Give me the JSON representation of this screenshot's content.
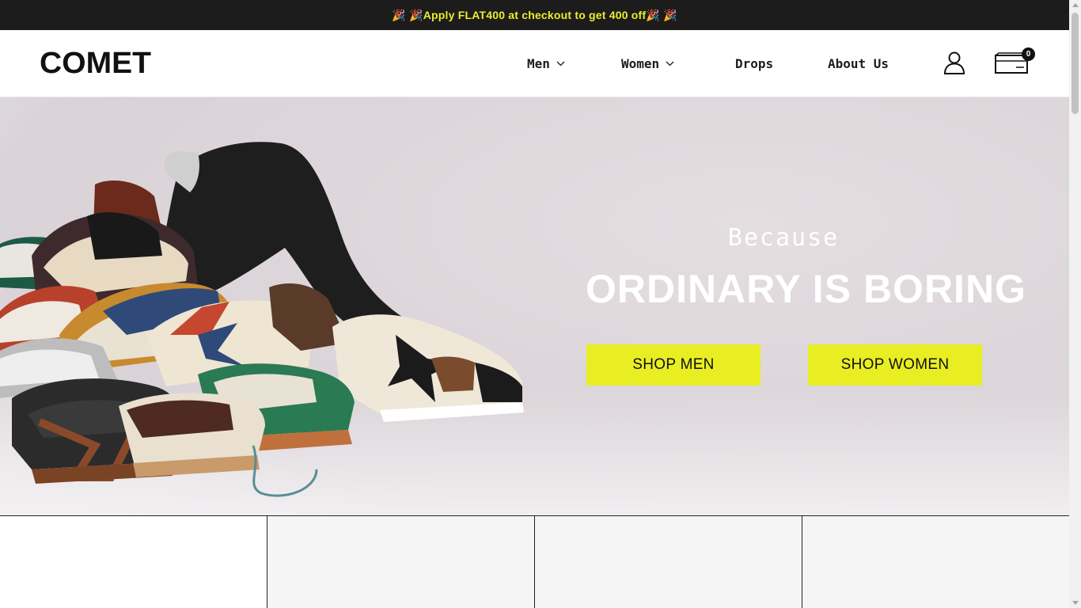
{
  "announcement": {
    "text": "🎉 🎉Apply FLAT400 at checkout to get 400 off🎉 🎉"
  },
  "header": {
    "logo_text": "COMET",
    "nav": [
      {
        "label": "Men",
        "has_dropdown": true
      },
      {
        "label": "Women",
        "has_dropdown": true
      },
      {
        "label": "Drops",
        "has_dropdown": false
      },
      {
        "label": "About Us",
        "has_dropdown": false
      }
    ],
    "account_icon": "user-icon",
    "cart_icon": "cart-icon",
    "cart_count": "0"
  },
  "hero": {
    "kicker": "Because",
    "headline": "ORDINARY IS BORING",
    "cta_men": "SHOP MEN",
    "cta_women": "SHOP WOMEN",
    "image": "pile-of-sneakers-with-person-lying"
  },
  "colors": {
    "announcement_bg": "#1c1c1c",
    "announcement_text": "#e9ee2b",
    "cta_bg": "#e8ee22",
    "text_dark": "#1c1c1c"
  }
}
